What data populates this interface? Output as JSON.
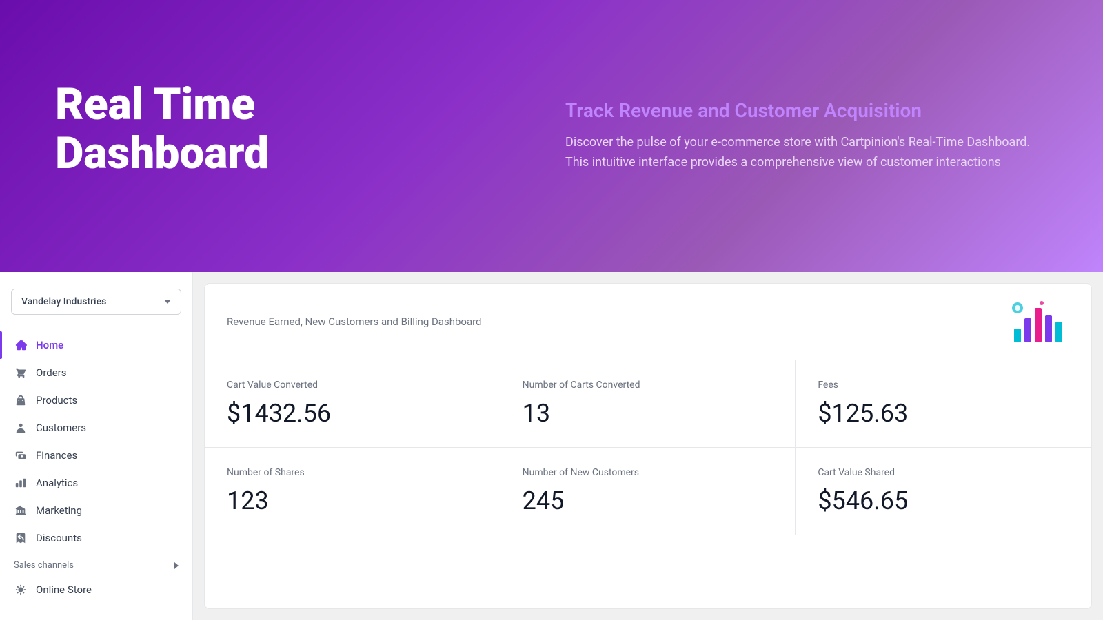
{
  "hero": {
    "title": "Real Time\nDashboard",
    "subtitle": "Track Revenue and Customer Acquisition",
    "description": "Discover the pulse of your e-commerce store with Cartpinion's Real-Time Dashboard. This intuitive interface provides a comprehensive view of customer interactions"
  },
  "sidebar": {
    "store_name": "Vandelay Industries",
    "nav_items": [
      {
        "label": "Home",
        "active": true,
        "icon": "home"
      },
      {
        "label": "Orders",
        "active": false,
        "icon": "orders"
      },
      {
        "label": "Products",
        "active": false,
        "icon": "products"
      },
      {
        "label": "Customers",
        "active": false,
        "icon": "customers"
      },
      {
        "label": "Finances",
        "active": false,
        "icon": "finances"
      },
      {
        "label": "Analytics",
        "active": false,
        "icon": "analytics"
      },
      {
        "label": "Marketing",
        "active": false,
        "icon": "marketing"
      },
      {
        "label": "Discounts",
        "active": false,
        "icon": "discounts"
      }
    ],
    "sales_channels_label": "Sales channels",
    "online_store_label": "Online Store"
  },
  "dashboard": {
    "header_title": "Revenue Earned, New Customers and Billing Dashboard",
    "metrics": [
      {
        "label": "Cart Value Converted",
        "value": "$1432.56"
      },
      {
        "label": "Number of Carts Converted",
        "value": "13"
      },
      {
        "label": "Fees",
        "value": "$125.63"
      },
      {
        "label": "Number of Shares",
        "value": "123"
      },
      {
        "label": "Number of New Customers",
        "value": "245"
      },
      {
        "label": "Cart Value Shared",
        "value": "$546.65"
      }
    ]
  }
}
